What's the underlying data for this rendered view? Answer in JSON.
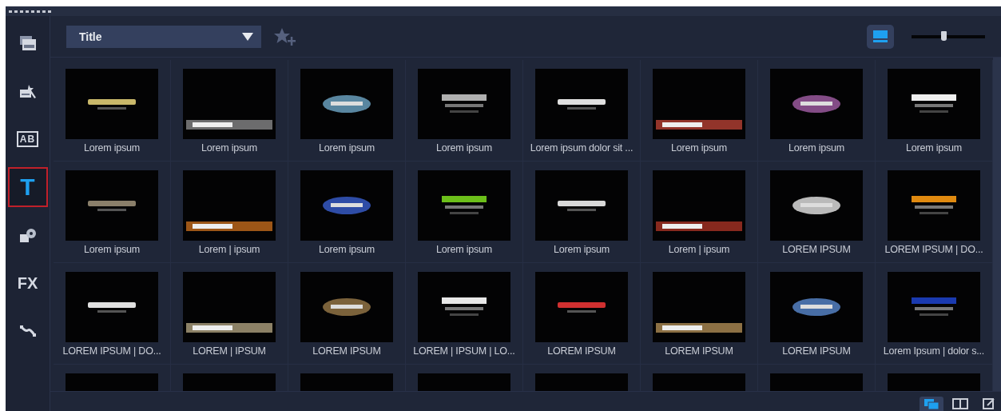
{
  "sidebar": {
    "items": [
      {
        "kind": "media",
        "selected": false
      },
      {
        "kind": "instant-project",
        "selected": false
      },
      {
        "kind": "transition",
        "label": "AB",
        "selected": false
      },
      {
        "kind": "title",
        "label": "T",
        "selected": true
      },
      {
        "kind": "graphics",
        "selected": false
      },
      {
        "kind": "filter",
        "label": "FX",
        "selected": false
      },
      {
        "kind": "path",
        "selected": false
      }
    ]
  },
  "toolbar": {
    "category_dropdown": {
      "value": "Title"
    },
    "view_toggle": {
      "selected": true
    },
    "zoom_slider": {
      "level": 0.43
    }
  },
  "grid": {
    "items": [
      {
        "label": "Lorem ipsum"
      },
      {
        "label": "Lorem ipsum"
      },
      {
        "label": "Lorem ipsum"
      },
      {
        "label": "Lorem ipsum"
      },
      {
        "label": "Lorem ipsum dolor sit ..."
      },
      {
        "label": "Lorem ipsum"
      },
      {
        "label": "Lorem ipsum"
      },
      {
        "label": "Lorem ipsum"
      },
      {
        "label": "Lorem ipsum"
      },
      {
        "label": "Lorem | ipsum"
      },
      {
        "label": "Lorem ipsum"
      },
      {
        "label": "Lorem ipsum"
      },
      {
        "label": "Lorem ipsum"
      },
      {
        "label": "Lorem | ipsum"
      },
      {
        "label": "LOREM IPSUM"
      },
      {
        "label": "LOREM IPSUM | DO..."
      },
      {
        "label": "LOREM IPSUM | DO..."
      },
      {
        "label": "LOREM | IPSUM"
      },
      {
        "label": "LOREM IPSUM"
      },
      {
        "label": "LOREM | IPSUM | LO..."
      },
      {
        "label": "LOREM IPSUM"
      },
      {
        "label": "LOREM IPSUM"
      },
      {
        "label": "LOREM IPSUM"
      },
      {
        "label": "Lorem Ipsum |  dolor s..."
      }
    ]
  },
  "bottom_bar": {
    "buttons": [
      {
        "kind": "stacked",
        "selected": true
      },
      {
        "kind": "split",
        "selected": false
      },
      {
        "kind": "edit",
        "selected": false
      }
    ]
  }
}
